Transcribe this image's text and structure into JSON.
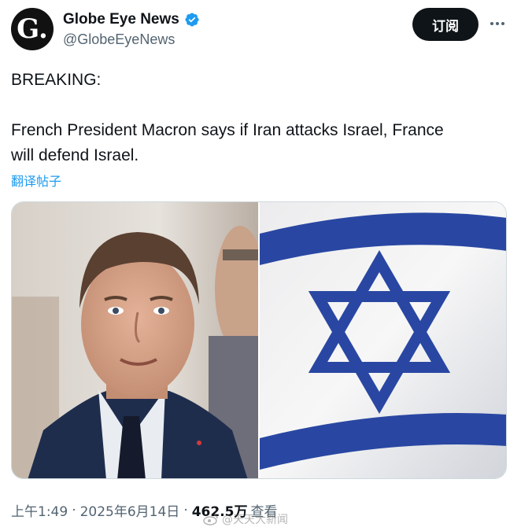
{
  "author": {
    "display_name": "Globe Eye News",
    "handle": "@GlobeEyeNews",
    "avatar_letter": "G."
  },
  "actions": {
    "subscribe_label": "订阅"
  },
  "tweet": {
    "line1": "BREAKING:",
    "line2": "French President Macron says if Iran attacks Israel, France",
    "line3": "will defend Israel.",
    "translate_label": "翻译帖子"
  },
  "meta": {
    "time": "上午1:49",
    "date": "2025年6月14日",
    "views_count": "462.5万",
    "views_label": "查看",
    "separator": "·"
  },
  "watermark": {
    "text": "@天天大新闻"
  },
  "colors": {
    "accent": "#1d9bf0",
    "text": "#0f1419",
    "secondary": "#536471",
    "flag_blue": "#2b4aa8"
  }
}
